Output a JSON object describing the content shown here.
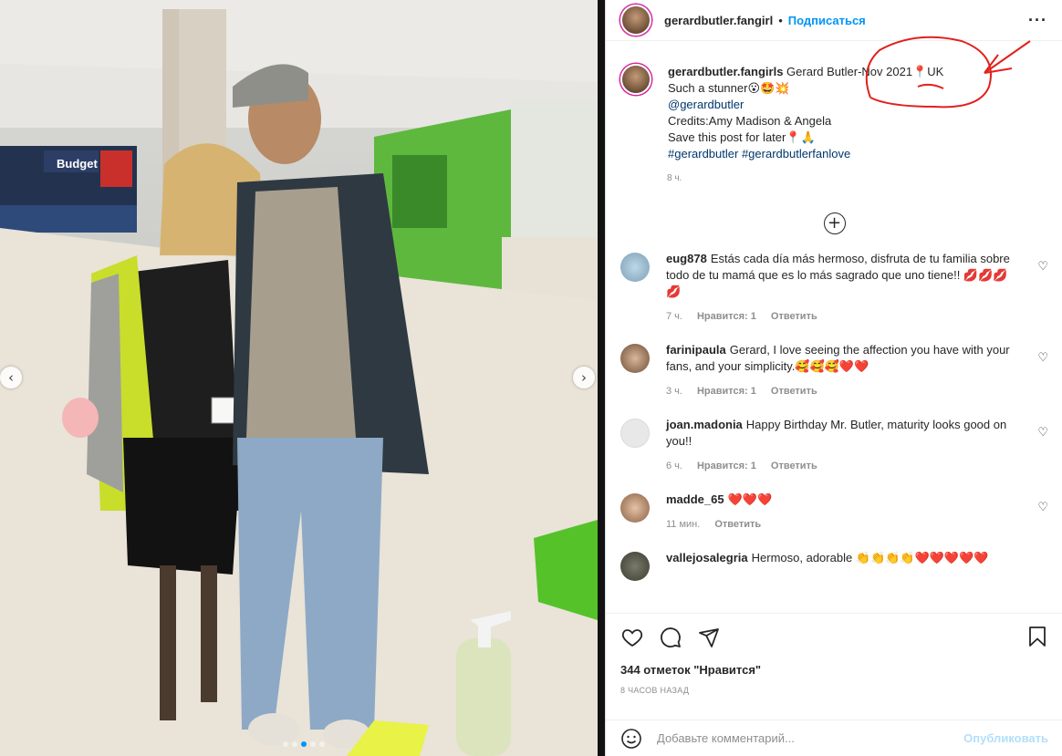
{
  "post": {
    "author": "gerardbutler.fangirl",
    "follow_label": "Подписаться",
    "more_icon": "more-horizontal-icon"
  },
  "caption": {
    "username": "gerardbutler.fangirls",
    "line1": "Gerard Butler-Nov 2021📍UK",
    "line2": "Such a stunner😮🤩💥",
    "mention": "@gerardbutler",
    "line4": "Credits:Amy Madison & Angela",
    "line5": "Save this post for later📍🙏",
    "hashtags": "#gerardbutler #gerardbutlerfanlove",
    "time": "8 ч."
  },
  "load_more_icon": "plus-circle-icon",
  "comments": [
    {
      "username": "eug878",
      "text": "Estás cada día más hermoso, disfruta de tu familia sobre todo de tu mamá que es lo más sagrado que uno tiene!! 💋💋💋💋",
      "time": "7 ч.",
      "likes": "Нравится: 1",
      "reply": "Ответить"
    },
    {
      "username": "farinipaula",
      "text": "Gerard, I love seeing the affection you have with your fans, and your simplicity.🥰🥰🥰❤️❤️",
      "time": "3 ч.",
      "likes": "Нравится: 1",
      "reply": "Ответить"
    },
    {
      "username": "joan.madonia",
      "text": "Happy Birthday Mr. Butler, maturity looks good on you!!",
      "time": "6 ч.",
      "likes": "Нравится: 1",
      "reply": "Ответить"
    },
    {
      "username": "madde_65",
      "text": "❤️❤️❤️",
      "time": "11 мин.",
      "likes": "",
      "reply": "Ответить"
    },
    {
      "username": "vallejosalegria",
      "text": "Hermoso, adorable 👏👏👏👏❤️❤️❤️❤️❤️",
      "time": "",
      "likes": "",
      "reply": ""
    }
  ],
  "actions": {
    "likes": "344 отметок \"Нравится\"",
    "time": "8 ЧАСОВ НАЗАД",
    "comment_placeholder": "Добавьте комментарий...",
    "publish": "Опубликовать"
  },
  "colors": {
    "accent": "#0095f6",
    "annotation": "#e0211d"
  }
}
